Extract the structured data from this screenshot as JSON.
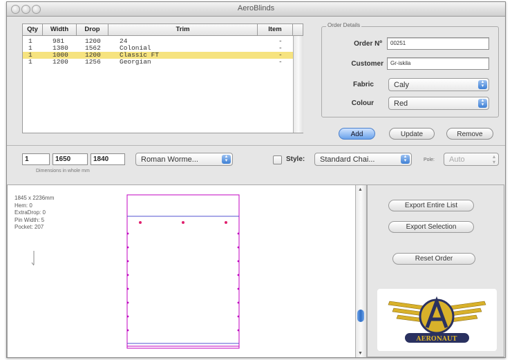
{
  "window": {
    "title": "AeroBlinds"
  },
  "order_table": {
    "columns": [
      "Qty",
      "Width",
      "Drop",
      "Trim",
      "Item"
    ],
    "rows": [
      {
        "qty": "1",
        "width": "981",
        "drop": "1200",
        "trim": "24",
        "item": "-"
      },
      {
        "qty": "1",
        "width": "1380",
        "drop": "1562",
        "trim": "Colonial",
        "item": "-"
      },
      {
        "qty": "1",
        "width": "1000",
        "drop": "1200",
        "trim": "Classic FT",
        "item": "-"
      },
      {
        "qty": "1",
        "width": "1200",
        "drop": "1256",
        "trim": "Georgian",
        "item": "-"
      }
    ],
    "selected_row_index": 2
  },
  "order_details": {
    "group_label": "Order Details",
    "order_no_label": "Order Nº",
    "order_no_value": "00251",
    "customer_label": "Customer",
    "customer_value": "Gr-iskila",
    "fabric_label": "Fabric",
    "fabric_value": "Caly",
    "colour_label": "Colour",
    "colour_value": "Red"
  },
  "buttons": {
    "add": "Add",
    "update": "Update",
    "remove": "Remove",
    "export_all": "Export Entire List",
    "export_selection": "Export Selection",
    "reset_order": "Reset Order"
  },
  "entry": {
    "qty": "1",
    "width": "1650",
    "drop": "1840",
    "trim_value": "Roman Worme...",
    "dims_hint": "Dimensions in whole mm",
    "style_label": "Style:",
    "style_value": "Standard Chai...",
    "pole_label": "Pole:",
    "pole_value": "Auto"
  },
  "preview_info": {
    "line1": "1845 x 2236mm",
    "line2": "Hem: 0",
    "line3": "ExtraDrop: 0",
    "line4": "Pin Width: 5",
    "line5": "Pocket: 207"
  },
  "logo": {
    "text": "AERONAUT"
  },
  "colors": {
    "selection": "#f6e37f",
    "accent_blue": "#3d7fd4",
    "blind_outline": "#c000c0",
    "logo_gold": "#d8b12a",
    "logo_navy": "#2a3160"
  }
}
